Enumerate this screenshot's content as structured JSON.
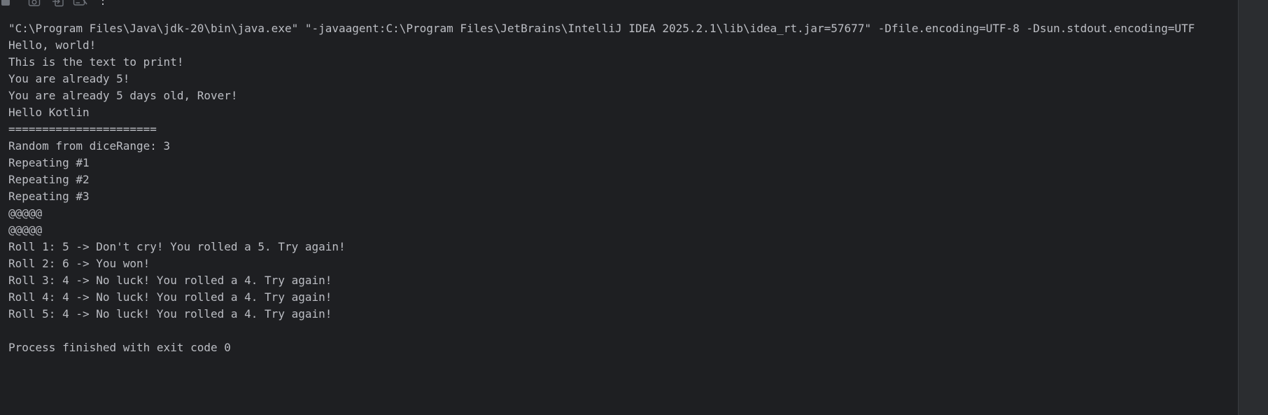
{
  "toolbar": {
    "buttons": [
      {
        "icon": "stop-icon"
      },
      {
        "icon": "camera-icon"
      },
      {
        "icon": "export-icon"
      },
      {
        "icon": "print-icon"
      },
      {
        "icon": "more-options-icon",
        "label": ":"
      }
    ]
  },
  "console": {
    "lines": [
      "\"C:\\Program Files\\Java\\jdk-20\\bin\\java.exe\" \"-javaagent:C:\\Program Files\\JetBrains\\IntelliJ IDEA 2025.2.1\\lib\\idea_rt.jar=57677\" -Dfile.encoding=UTF-8 -Dsun.stdout.encoding=UTF",
      "Hello, world!",
      "This is the text to print!",
      "You are already 5!",
      "You are already 5 days old, Rover!",
      "Hello Kotlin",
      "======================",
      "Random from diceRange: 3",
      "Repeating #1",
      "Repeating #2",
      "Repeating #3",
      "@@@@@",
      "@@@@@",
      "Roll 1: 5 -> Don't cry! You rolled a 5. Try again!",
      "Roll 2: 6 -> You won!",
      "Roll 3: 4 -> No luck! You rolled a 4. Try again!",
      "Roll 4: 4 -> No luck! You rolled a 4. Try again!",
      "Roll 5: 4 -> No luck! You rolled a 4. Try again!",
      "",
      "Process finished with exit code 0"
    ]
  },
  "colors": {
    "background": "#1e1f22",
    "text": "#bcbec4",
    "icon": "#6f737a",
    "scrollbar": "#2b2d30"
  }
}
